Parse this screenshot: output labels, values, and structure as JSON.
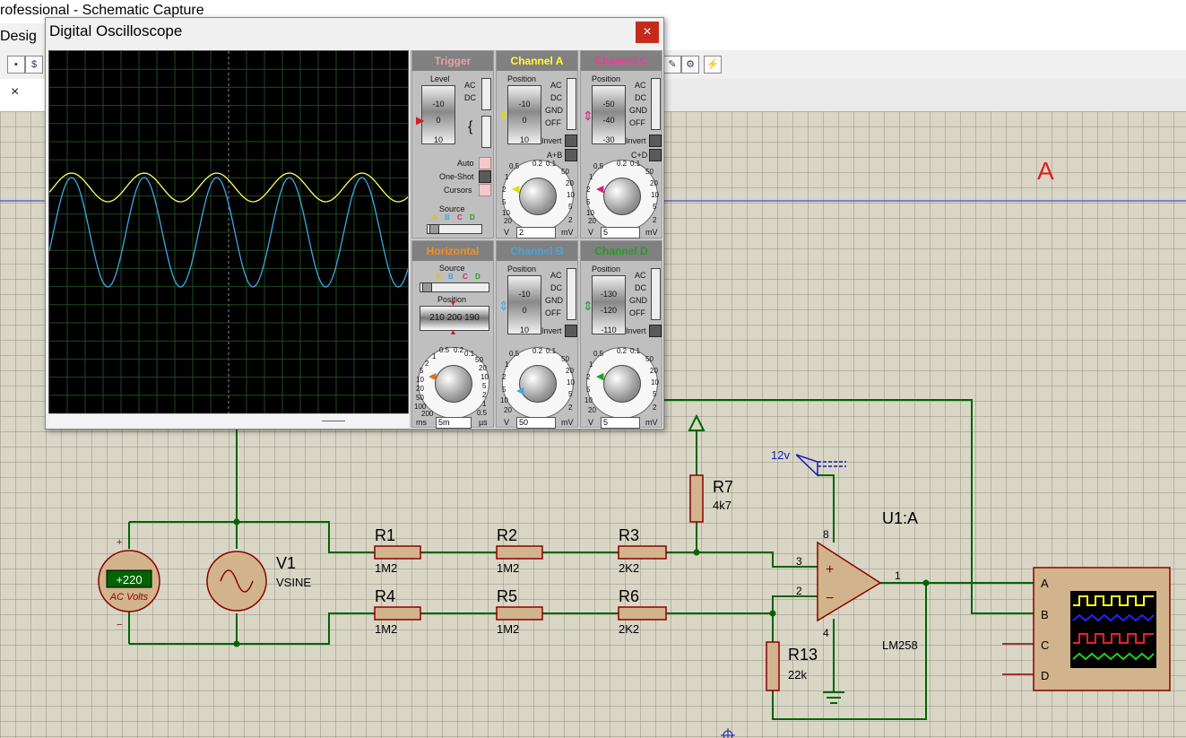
{
  "app": {
    "title": "rofessional - Schematic Capture",
    "menu_fragment": "Desig",
    "tab_close": "×"
  },
  "scope": {
    "title": "Digital Oscilloscope",
    "close": "×",
    "trace_a_color": "#ffff66",
    "trace_b_color": "#3fa7e0",
    "trigger": {
      "header": "Trigger",
      "level_label": "Level",
      "level_ticks": [
        "-10",
        "0",
        "10"
      ],
      "coupling": [
        "AC",
        "DC"
      ],
      "modes": [
        "Auto",
        "One-Shot",
        "Cursors"
      ],
      "source_label": "Source",
      "source_letters": [
        "A",
        "B",
        "C",
        "D"
      ]
    },
    "channel_a": {
      "header": "Channel A",
      "position_label": "Position",
      "ticks": [
        "-10",
        "0",
        "10"
      ],
      "coupling": [
        "AC",
        "DC",
        "GND",
        "OFF"
      ],
      "extra": [
        "Invert",
        "A+B"
      ],
      "dial_units": [
        "V",
        "mV"
      ],
      "value": "2",
      "dial_ticks_left": [
        "0.5",
        "1",
        "2",
        "5",
        "10",
        "20"
      ],
      "dial_ticks_right": [
        "0.2",
        "0.1",
        "50",
        "20",
        "10",
        "5",
        "2"
      ]
    },
    "channel_c": {
      "header": "Channel C",
      "position_label": "Position",
      "ticks": [
        "-50",
        "-40",
        "-30"
      ],
      "coupling": [
        "AC",
        "DC",
        "GND",
        "OFF"
      ],
      "extra": [
        "Invert",
        "C+D"
      ],
      "dial_units": [
        "V",
        "mV"
      ],
      "value": "5",
      "dial_ticks_left": [
        "0.5",
        "1",
        "2",
        "5",
        "10",
        "20"
      ],
      "dial_ticks_right": [
        "0.2",
        "0.1",
        "50",
        "20",
        "10",
        "5",
        "2"
      ]
    },
    "horizontal": {
      "header": "Horizontal",
      "source_label": "Source",
      "source_letters": [
        "A",
        "B",
        "C",
        "D"
      ],
      "position_label": "Position",
      "position_values": [
        "210",
        "200",
        "190"
      ],
      "dial_units": [
        "ms",
        "µs"
      ],
      "value": "5m",
      "dial_ticks_left": [
        "0.5",
        "1",
        "2",
        "5",
        "10",
        "20",
        "50",
        "100",
        "200"
      ],
      "dial_ticks_right": [
        "0.2",
        "0.1",
        "50",
        "20",
        "10",
        "5",
        "2",
        "1",
        "0.5"
      ]
    },
    "channel_b": {
      "header": "Channel B",
      "position_label": "Position",
      "ticks": [
        "-10",
        "0",
        "10"
      ],
      "coupling": [
        "AC",
        "DC",
        "GND",
        "OFF"
      ],
      "extra": [
        "Invert"
      ],
      "dial_units": [
        "V",
        "mV"
      ],
      "value": "50",
      "dial_ticks_left": [
        "0.5",
        "1",
        "2",
        "5",
        "10",
        "20"
      ],
      "dial_ticks_right": [
        "0.2",
        "0.1",
        "50",
        "20",
        "10",
        "5",
        "2"
      ]
    },
    "channel_d": {
      "header": "Channel D",
      "position_label": "Position",
      "ticks": [
        "-130",
        "-120",
        "-110"
      ],
      "coupling": [
        "AC",
        "DC",
        "GND",
        "OFF"
      ],
      "extra": [
        "Invert"
      ],
      "dial_units": [
        "V",
        "mV"
      ],
      "value": "5",
      "dial_ticks_left": [
        "0.5",
        "1",
        "2",
        "5",
        "10",
        "20"
      ],
      "dial_ticks_right": [
        "0.2",
        "0.1",
        "50",
        "20",
        "10",
        "5",
        "2"
      ]
    }
  },
  "schematic": {
    "marker_a": "A",
    "wire_color": "#006400",
    "component_outline": "#8b0000",
    "body_fill": "#d2b48c",
    "voltmeter": {
      "reading": "+220",
      "label": "AC Volts",
      "plus": "+",
      "minus": "−"
    },
    "source": {
      "name": "V1",
      "type": "VSINE"
    },
    "resistors": [
      {
        "name": "R1",
        "value": "1M2"
      },
      {
        "name": "R2",
        "value": "1M2"
      },
      {
        "name": "R3",
        "value": "2K2"
      },
      {
        "name": "R4",
        "value": "1M2"
      },
      {
        "name": "R5",
        "value": "1M2"
      },
      {
        "name": "R6",
        "value": "2K2"
      },
      {
        "name": "R7",
        "value": "4k7"
      },
      {
        "name": "R13",
        "value": "22k"
      }
    ],
    "opamp": {
      "name": "U1:A",
      "part": "LM258",
      "pins": [
        "8",
        "3",
        "2",
        "4",
        "1"
      ]
    },
    "supply_label": "12v",
    "scope_inputs": [
      "A",
      "B",
      "C",
      "D"
    ]
  }
}
